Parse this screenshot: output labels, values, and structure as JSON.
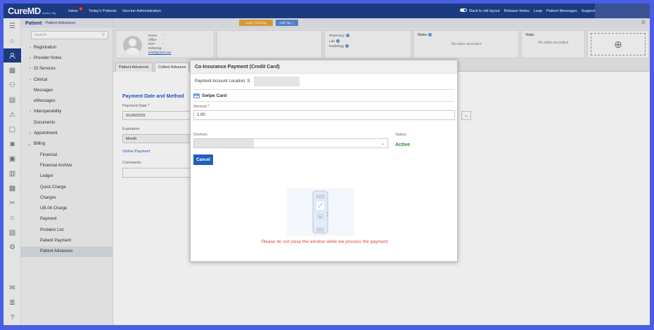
{
  "topbar": {
    "logo": "CureMD",
    "logo_sub": "version 9ig",
    "inbox": "Inbox",
    "inbox_badge": "1",
    "todays_patients": "Today's Patients",
    "vaccine_admin": "Vaccine Administration",
    "back_old_layout": "Back to old layout",
    "release_notes": "Release Notes",
    "leap": "Leap",
    "patient_messages": "Patient Messages",
    "support": "Support"
  },
  "sidebar": {
    "title": "Patient",
    "subtitle": "- Patient Advances",
    "search_placeholder": "Search",
    "items": [
      {
        "label": "Registration",
        "chevron": true
      },
      {
        "label": "Provider Notes",
        "chevron": true
      },
      {
        "label": "GI Services",
        "chevron": true
      },
      {
        "label": "Clinical",
        "chevron": true
      },
      {
        "label": "Messages",
        "chevron": false
      },
      {
        "label": "eMessages",
        "chevron": false
      },
      {
        "label": "Interoperability",
        "chevron": true
      },
      {
        "label": "Documents",
        "chevron": false
      },
      {
        "label": "Appointment",
        "chevron": true
      },
      {
        "label": "Billing",
        "chevron": true,
        "expanded": true
      }
    ],
    "billing_items": [
      "Financial",
      "Financial Archive",
      "Ledger",
      "Quick Charge",
      "Charges",
      "UB-04 Charge",
      "Payment",
      "Problem List",
      "Patient Payment",
      "Patient Advances"
    ]
  },
  "header": {
    "leap_badge": "Leap: Pending",
    "add_tag": "Add Tag"
  },
  "patient": {
    "home_label": "Home",
    "office_label": "Office",
    "pcp_label": "PCP",
    "referring_label": "Referring",
    "dash": "-",
    "email": "test@gmail.com",
    "pharmacy": "Pharmacy",
    "lab": "Lab",
    "radiology": "Radiology",
    "notes_title": "Notes",
    "notes_empty": "No data recorded",
    "vitals_title": "Vitals",
    "vitals_empty": "No data recorded"
  },
  "tabs": [
    "Patient Advances",
    "Collect Advance"
  ],
  "form": {
    "section_title": "Payment Date and Method",
    "payment_date_label": "Payment Date",
    "payment_date_value": "01/06/2025",
    "expiration_label": "Expiration",
    "expiration_value": "Month",
    "online_payment": "Online Payment",
    "comments_label": "Comments"
  },
  "modal": {
    "title": "Co-Insurance Payment (Credit Card)",
    "location_label": "Payment Account Location: S",
    "swipe_card": "Swipe Card",
    "amount_label": "Amount",
    "amount_value": "1.00",
    "devices_label": "Devices:",
    "status_label": "Status",
    "status_value": "Active",
    "cancel_button": "Cancel",
    "warning": "Please do not close the window while we process the payment"
  },
  "colors": {
    "brand": "#1f3f8a",
    "link": "#1f5fbf",
    "status_active": "#2a8a2a",
    "warning": "#e04545",
    "leap": "#e7a53a"
  }
}
